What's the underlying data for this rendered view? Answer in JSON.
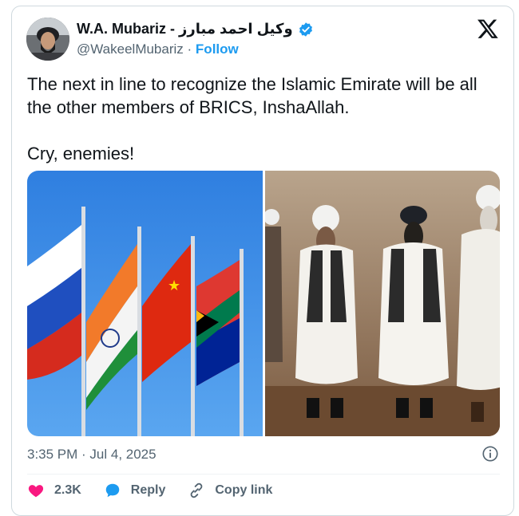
{
  "author": {
    "name": "W.A. Mubariz - وکیل احمد مبارز",
    "handle": "@WakeelMubariz",
    "separator": "·",
    "follow_label": "Follow"
  },
  "icons": {
    "verified": "verified-badge-icon",
    "brand": "x-logo-icon",
    "info": "info-icon",
    "like": "heart-icon",
    "reply": "reply-bubble-icon",
    "copy": "link-icon"
  },
  "tweet": {
    "line1": "The next in line to recognize the Islamic Emirate will be all the other members of BRICS, InshaAllah.",
    "line2": "Cry, enemies!"
  },
  "timestamp": "3:35 PM · Jul 4, 2025",
  "actions": {
    "like_count": "2.3K",
    "reply_label": "Reply",
    "copy_label": "Copy link"
  },
  "colors": {
    "accent": "#1d9bf0",
    "like": "#f91880",
    "text": "#0f1419",
    "muted": "#536471"
  }
}
